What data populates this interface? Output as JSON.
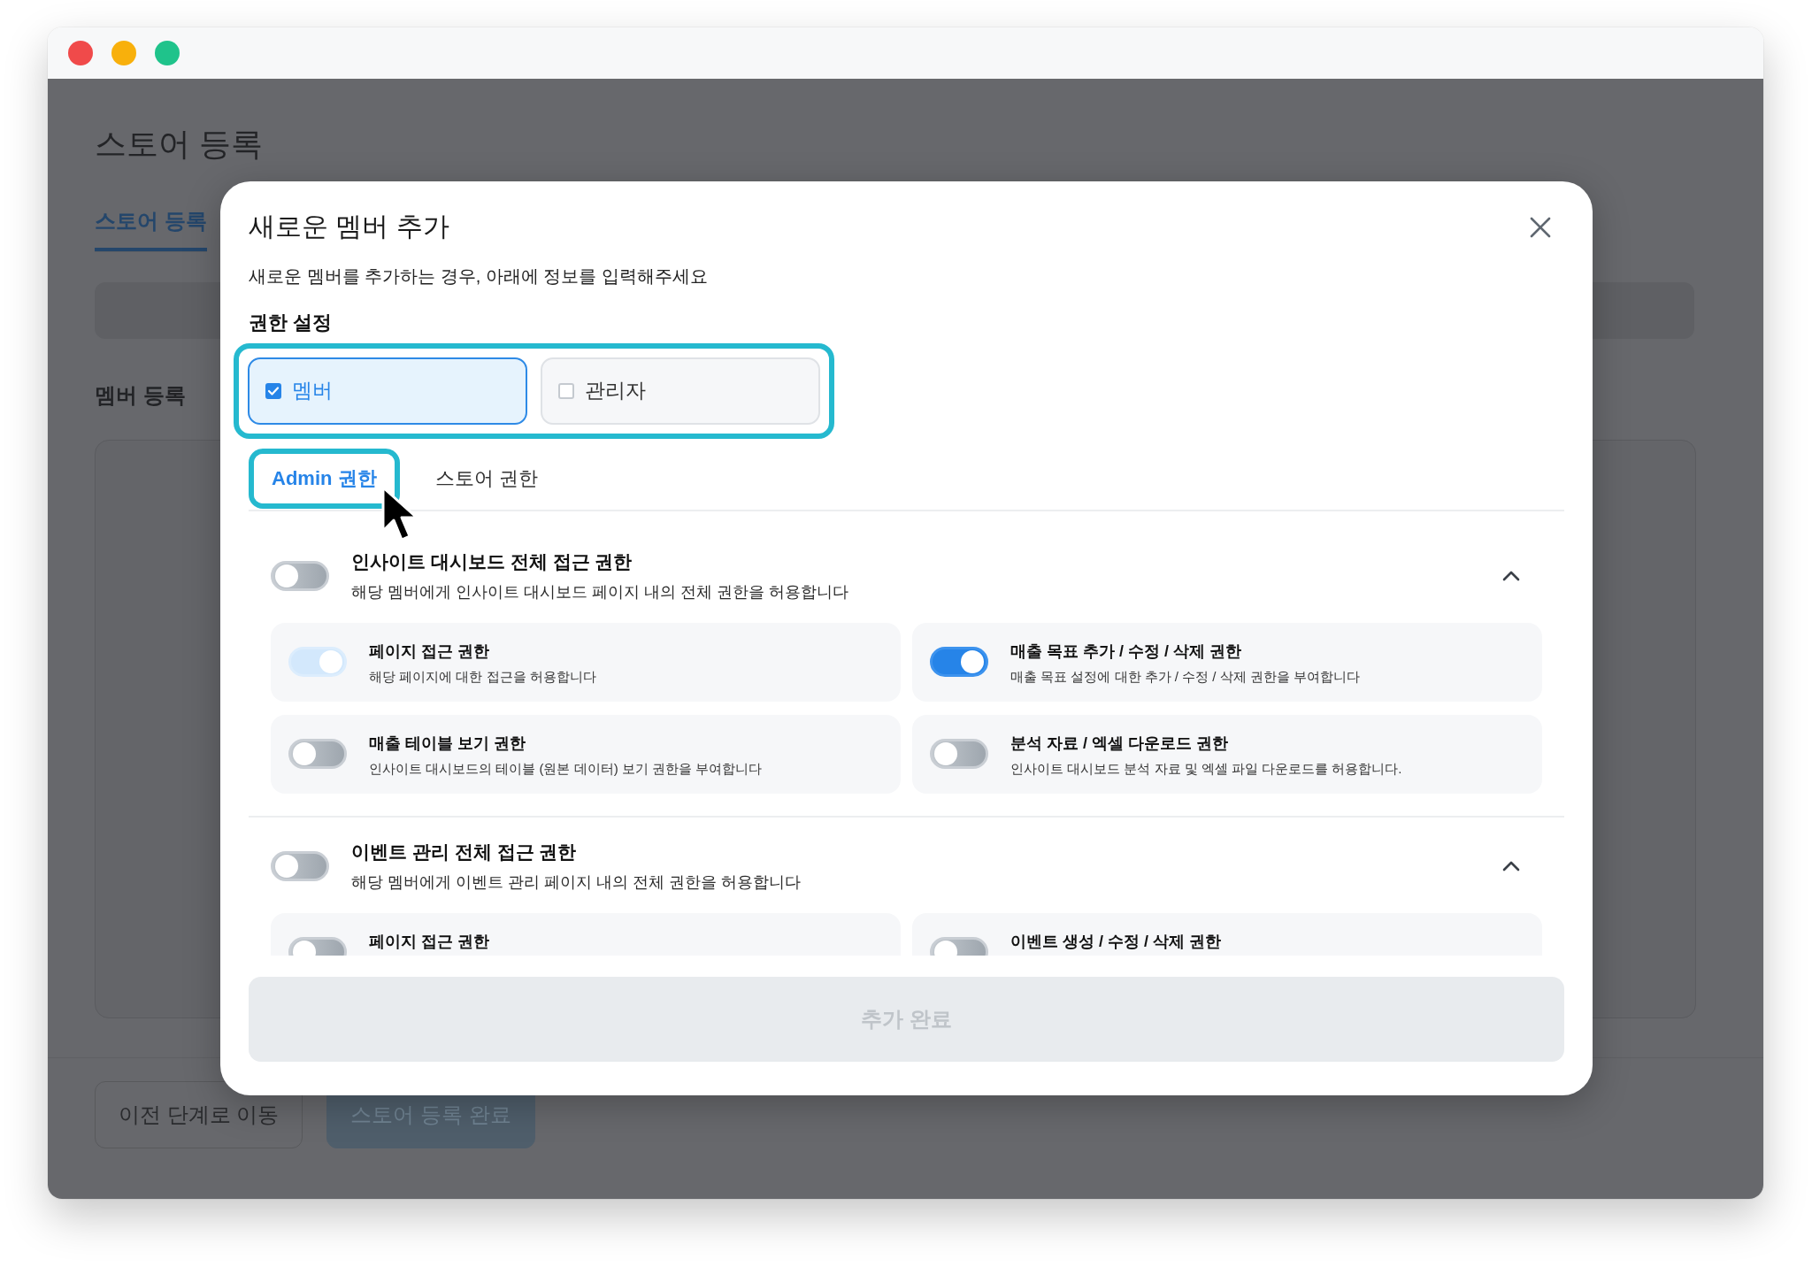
{
  "background_page": {
    "title": "스토어 등록",
    "tabs": [
      {
        "label": "스토어 등록",
        "selected": true
      }
    ],
    "section_title": "멤버 등록",
    "buttons": [
      {
        "label": "이전 단계로 이동",
        "kind": "secondary"
      },
      {
        "label": "스토어 등록 완료",
        "kind": "primary"
      }
    ]
  },
  "modal": {
    "title": "새로운 멤버 추가",
    "subtitle": "새로운 멤버를 추가하는 경우, 아래에 정보를 입력해주세요",
    "permission_label": "권한 설정",
    "roles_highlighted": true,
    "roles": [
      {
        "label": "멤버",
        "selected": true
      },
      {
        "label": "관리자",
        "selected": false
      }
    ],
    "tabs": [
      {
        "label": "Admin 권한",
        "selected": true,
        "highlighted": true
      },
      {
        "label": "스토어 권한",
        "selected": false,
        "highlighted": false
      }
    ],
    "sections": [
      {
        "title": "인사이트 대시보드 전체 접근 권한",
        "description": "해당 멤버에게 인사이트 대시보드 페이지 내의 전체 권한을 허용합니다",
        "on": false,
        "expanded": true,
        "items": [
          {
            "title": "페이지 접근 권한",
            "description": "해당 페이지에 대한 접근을 허용합니다",
            "on": true,
            "disabled": true
          },
          {
            "title": "매출 목표 추가 / 수정 / 삭제 권한",
            "description": "매출 목표 설정에 대한 추가 / 수정 / 삭제 권한을 부여합니다",
            "on": true,
            "disabled": false
          },
          {
            "title": "매출 테이블 보기 권한",
            "description": "인사이트 대시보드의 테이블 (원본 데이터) 보기 권한을 부여합니다",
            "on": false,
            "disabled": false
          },
          {
            "title": "분석 자료 / 엑셀 다운로드 권한",
            "description": "인사이트 대시보드 분석 자료 및 엑셀 파일 다운로드를 허용합니다.",
            "on": false,
            "disabled": false
          }
        ]
      },
      {
        "title": "이벤트 관리 전체 접근 권한",
        "description": "해당 멤버에게 이벤트 관리 페이지 내의 전체 권한을 허용합니다",
        "on": false,
        "expanded": true,
        "items": [
          {
            "title": "페이지 접근 권한",
            "on": false
          },
          {
            "title": "이벤트 생성 / 수정 / 삭제 권한",
            "on": false
          }
        ]
      }
    ],
    "submit": {
      "label": "추가 완료",
      "disabled": true
    }
  }
}
